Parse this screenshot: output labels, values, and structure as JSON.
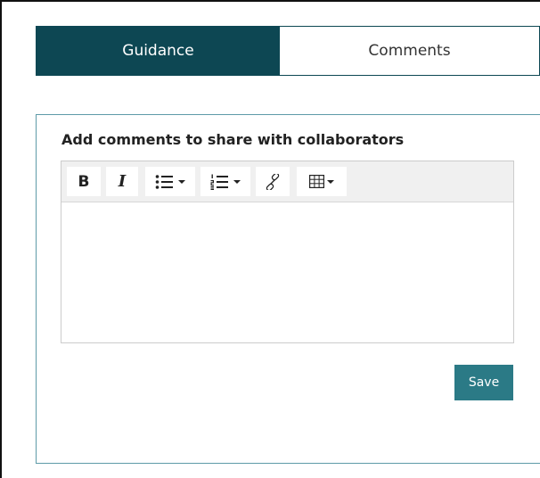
{
  "tabs": [
    {
      "label": "Guidance",
      "active": true
    },
    {
      "label": "Comments",
      "active": false
    }
  ],
  "panel": {
    "title": "Add comments to share with collaborators"
  },
  "toolbar": {
    "bold_label": "B",
    "italic_label": "I",
    "icons": [
      "bold-icon",
      "italic-icon",
      "bullet-list-icon",
      "numbered-list-icon",
      "link-icon",
      "table-icon"
    ]
  },
  "actions": {
    "save_label": "Save"
  },
  "colors": {
    "active_tab": "#0d4753",
    "panel_border": "#5e9ba8",
    "save_button": "#2b7a86"
  }
}
